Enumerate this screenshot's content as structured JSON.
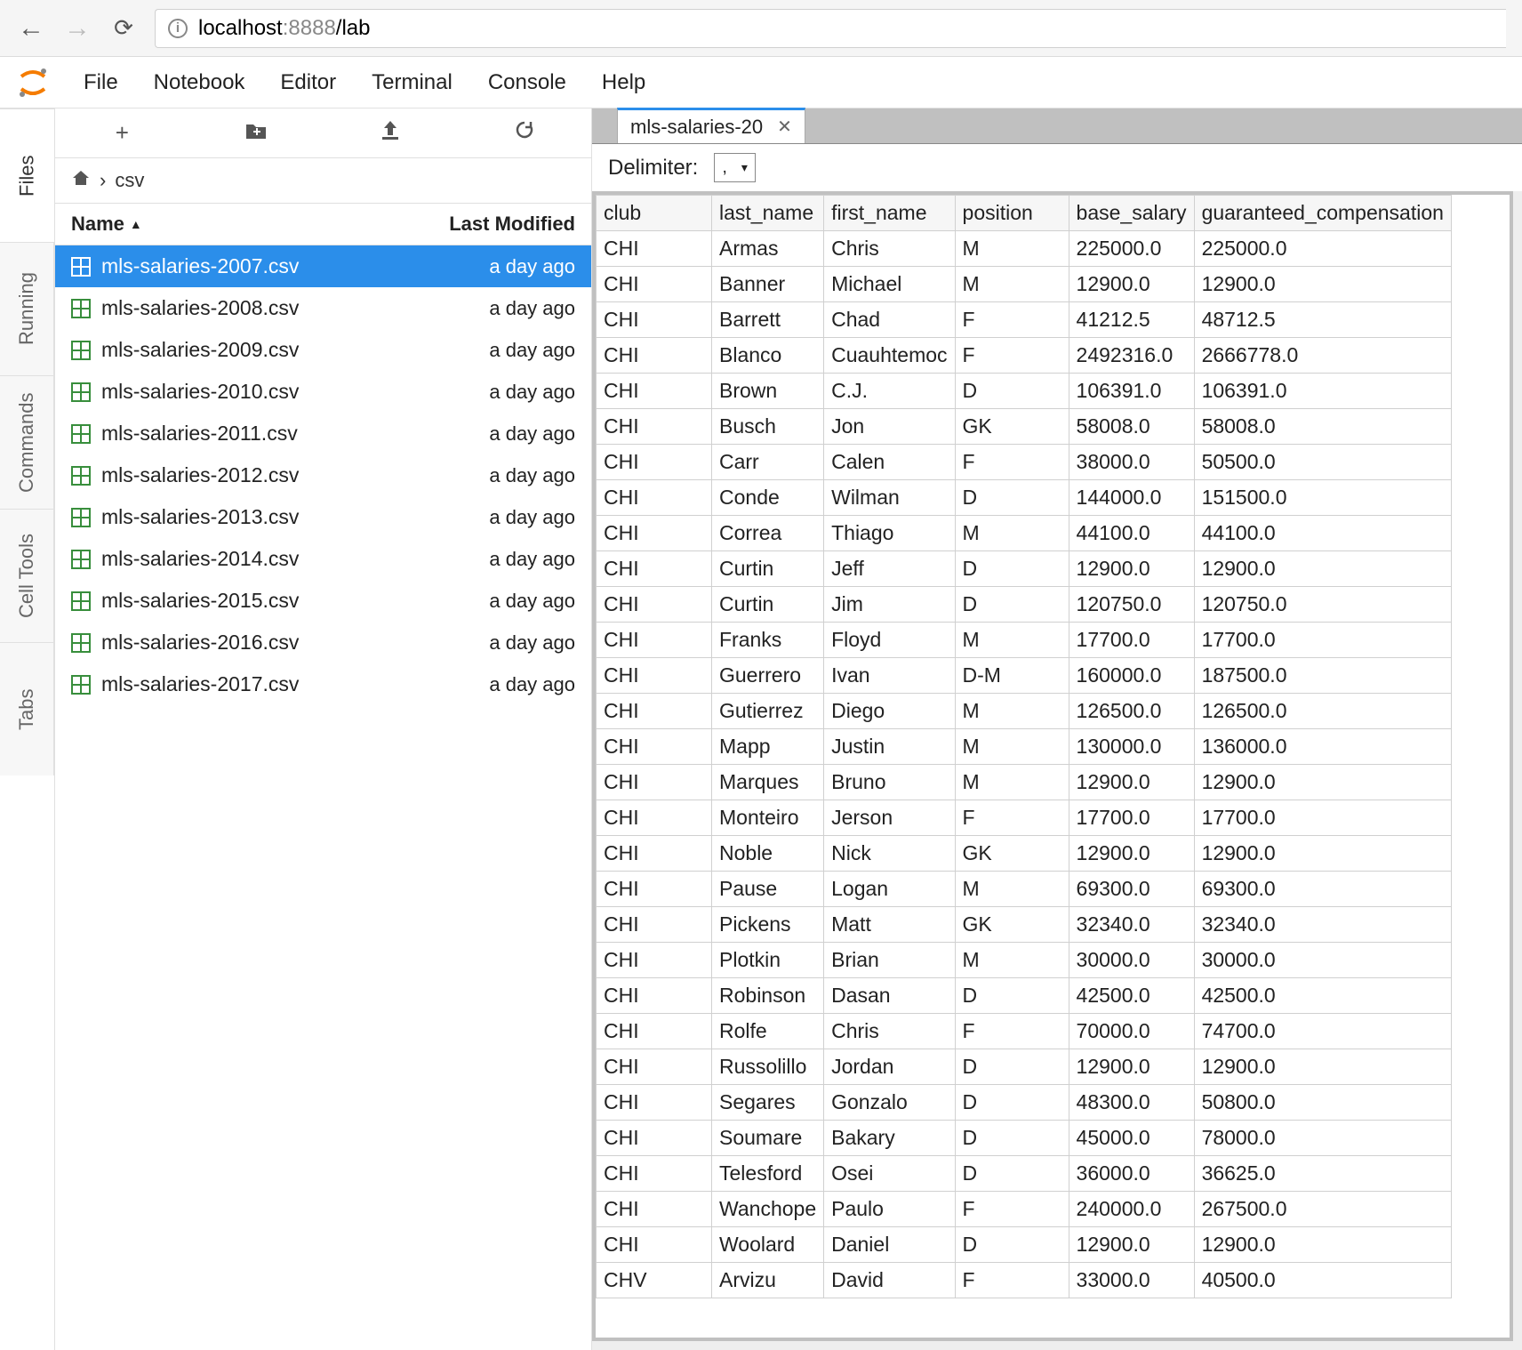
{
  "browser": {
    "host": "localhost",
    "port": ":8888",
    "path": "/lab"
  },
  "menubar": [
    "File",
    "Notebook",
    "Editor",
    "Terminal",
    "Console",
    "Help"
  ],
  "left_tabs": [
    "Files",
    "Running",
    "Commands",
    "Cell Tools",
    "Tabs"
  ],
  "file_toolbar": {
    "new": "+",
    "new_folder": "📁",
    "upload": "⬆",
    "refresh": "⟳"
  },
  "breadcrumb": {
    "home": "🏠",
    "sep": "›",
    "folder": "csv"
  },
  "file_header": {
    "name": "Name",
    "modified": "Last Modified"
  },
  "files": [
    {
      "name": "mls-salaries-2007.csv",
      "modified": "a day ago",
      "selected": true
    },
    {
      "name": "mls-salaries-2008.csv",
      "modified": "a day ago",
      "selected": false
    },
    {
      "name": "mls-salaries-2009.csv",
      "modified": "a day ago",
      "selected": false
    },
    {
      "name": "mls-salaries-2010.csv",
      "modified": "a day ago",
      "selected": false
    },
    {
      "name": "mls-salaries-2011.csv",
      "modified": "a day ago",
      "selected": false
    },
    {
      "name": "mls-salaries-2012.csv",
      "modified": "a day ago",
      "selected": false
    },
    {
      "name": "mls-salaries-2013.csv",
      "modified": "a day ago",
      "selected": false
    },
    {
      "name": "mls-salaries-2014.csv",
      "modified": "a day ago",
      "selected": false
    },
    {
      "name": "mls-salaries-2015.csv",
      "modified": "a day ago",
      "selected": false
    },
    {
      "name": "mls-salaries-2016.csv",
      "modified": "a day ago",
      "selected": false
    },
    {
      "name": "mls-salaries-2017.csv",
      "modified": "a day ago",
      "selected": false
    }
  ],
  "tab": {
    "label": "mls-salaries-20",
    "close": "✕"
  },
  "delimiter": {
    "label": "Delimiter:",
    "value": ","
  },
  "grid": {
    "headers": [
      "club",
      "last_name",
      "first_name",
      "position",
      "base_salary",
      "guaranteed_compensation"
    ],
    "rows": [
      [
        "CHI",
        "Armas",
        "Chris",
        "M",
        "225000.0",
        "225000.0"
      ],
      [
        "CHI",
        "Banner",
        "Michael",
        "M",
        "12900.0",
        "12900.0"
      ],
      [
        "CHI",
        "Barrett",
        "Chad",
        "F",
        "41212.5",
        "48712.5"
      ],
      [
        "CHI",
        "Blanco",
        "Cuauhtemoc",
        "F",
        "2492316.0",
        "2666778.0"
      ],
      [
        "CHI",
        "Brown",
        "C.J.",
        "D",
        "106391.0",
        "106391.0"
      ],
      [
        "CHI",
        "Busch",
        "Jon",
        "GK",
        "58008.0",
        "58008.0"
      ],
      [
        "CHI",
        "Carr",
        "Calen",
        "F",
        "38000.0",
        "50500.0"
      ],
      [
        "CHI",
        "Conde",
        "Wilman",
        "D",
        "144000.0",
        "151500.0"
      ],
      [
        "CHI",
        "Correa",
        "Thiago",
        "M",
        "44100.0",
        "44100.0"
      ],
      [
        "CHI",
        "Curtin",
        "Jeff",
        "D",
        "12900.0",
        "12900.0"
      ],
      [
        "CHI",
        "Curtin",
        "Jim",
        "D",
        "120750.0",
        "120750.0"
      ],
      [
        "CHI",
        "Franks",
        "Floyd",
        "M",
        "17700.0",
        "17700.0"
      ],
      [
        "CHI",
        "Guerrero",
        "Ivan",
        "D-M",
        "160000.0",
        "187500.0"
      ],
      [
        "CHI",
        "Gutierrez",
        "Diego",
        "M",
        "126500.0",
        "126500.0"
      ],
      [
        "CHI",
        "Mapp",
        "Justin",
        "M",
        "130000.0",
        "136000.0"
      ],
      [
        "CHI",
        "Marques",
        "Bruno",
        "M",
        "12900.0",
        "12900.0"
      ],
      [
        "CHI",
        "Monteiro",
        "Jerson",
        "F",
        "17700.0",
        "17700.0"
      ],
      [
        "CHI",
        "Noble",
        "Nick",
        "GK",
        "12900.0",
        "12900.0"
      ],
      [
        "CHI",
        "Pause",
        "Logan",
        "M",
        "69300.0",
        "69300.0"
      ],
      [
        "CHI",
        "Pickens",
        "Matt",
        "GK",
        "32340.0",
        "32340.0"
      ],
      [
        "CHI",
        "Plotkin",
        "Brian",
        "M",
        "30000.0",
        "30000.0"
      ],
      [
        "CHI",
        "Robinson",
        "Dasan",
        "D",
        "42500.0",
        "42500.0"
      ],
      [
        "CHI",
        "Rolfe",
        "Chris",
        "F",
        "70000.0",
        "74700.0"
      ],
      [
        "CHI",
        "Russolillo",
        "Jordan",
        "D",
        "12900.0",
        "12900.0"
      ],
      [
        "CHI",
        "Segares",
        "Gonzalo",
        "D",
        "48300.0",
        "50800.0"
      ],
      [
        "CHI",
        "Soumare",
        "Bakary",
        "D",
        "45000.0",
        "78000.0"
      ],
      [
        "CHI",
        "Telesford",
        "Osei",
        "D",
        "36000.0",
        "36625.0"
      ],
      [
        "CHI",
        "Wanchope",
        "Paulo",
        "F",
        "240000.0",
        "267500.0"
      ],
      [
        "CHI",
        "Woolard",
        "Daniel",
        "D",
        "12900.0",
        "12900.0"
      ],
      [
        "CHV",
        "Arvizu",
        "David",
        "F",
        "33000.0",
        "40500.0"
      ]
    ]
  }
}
